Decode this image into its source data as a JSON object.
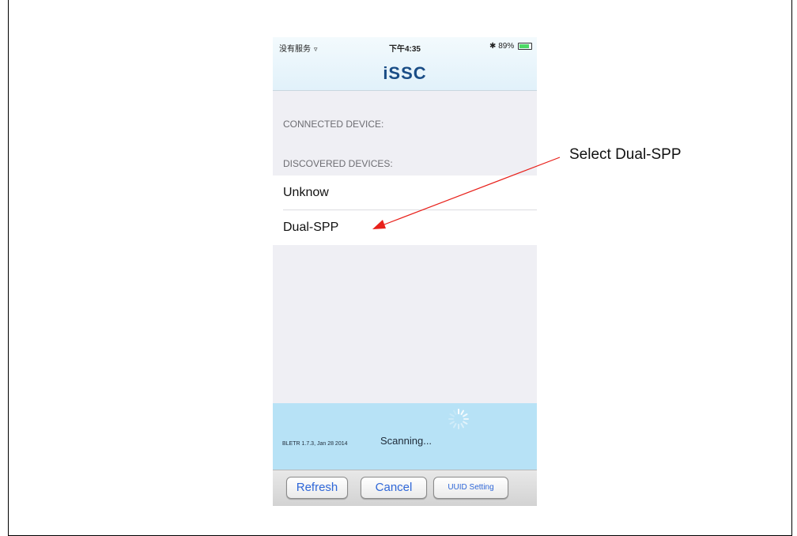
{
  "status_bar": {
    "carrier": "没有服务",
    "wifi_icon": "wifi-icon",
    "time": "下午4:35",
    "bluetooth_icon": "bluetooth-icon",
    "battery": "89%",
    "battery_level": 0.89
  },
  "nav": {
    "title": "iSSC"
  },
  "sections": {
    "connected": "CONNECTED DEVICE:",
    "discovered": "DISCOVERED DEVICES:"
  },
  "devices": [
    "Unknow",
    "Dual-SPP"
  ],
  "scan": {
    "version": "BLETR 1.7.3, Jan 28 2014",
    "status": "Scanning...",
    "spinner_icon": "activity-spinner-icon"
  },
  "toolbar": {
    "refresh": "Refresh",
    "cancel": "Cancel",
    "uuid": "UUID Setting"
  },
  "annotation": {
    "label": "Select Dual-SPP",
    "color": "#e8201a"
  }
}
